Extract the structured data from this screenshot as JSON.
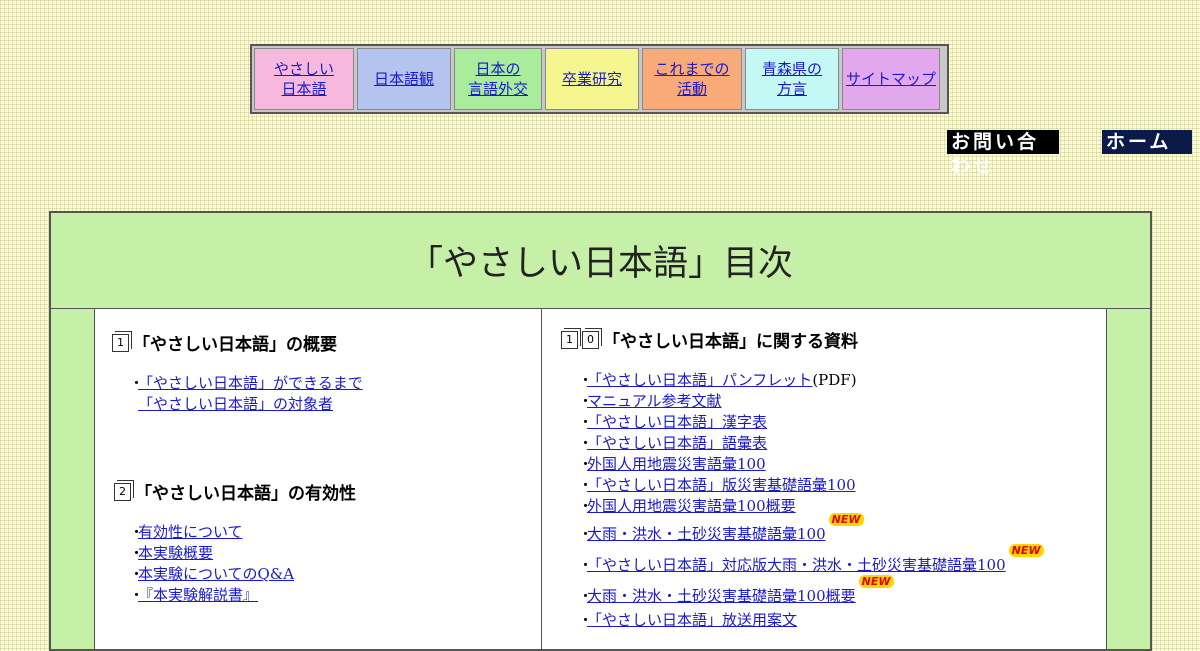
{
  "nav": [
    {
      "label": "やさしい\n日本語",
      "bg": "#f6b8dc"
    },
    {
      "label": "日本語観",
      "bg": "#b4c4ee"
    },
    {
      "label": "日本の\n言語外交",
      "bg": "#a8ec9c"
    },
    {
      "label": "卒業研究",
      "bg": "#f6f690"
    },
    {
      "label": "これまでの\n活動",
      "bg": "#f8aa78"
    },
    {
      "label": "青森県の\n方言",
      "bg": "#c4f8f4"
    },
    {
      "label": "サイトマップ",
      "bg": "#e2a8ee"
    }
  ],
  "header_links": {
    "contact": "お問い合わせ",
    "home": "ホーム"
  },
  "title": "「やさしい日本語」目次",
  "left": {
    "sec1": {
      "num": "1",
      "title": "「やさしい日本語」の概要",
      "items": [
        {
          "bullet": "・",
          "text": "「やさしい日本語」ができるまで"
        },
        {
          "bullet": "",
          "text": "「やさしい日本語」の対象者"
        }
      ]
    },
    "sec2": {
      "num": "2",
      "title": "「やさしい日本語」の有効性",
      "items": [
        {
          "bullet": "・",
          "text": "有効性について"
        },
        {
          "bullet": "・",
          "text": "本実験概要"
        },
        {
          "bullet": "・",
          "text": "本実験についてのQ&A"
        },
        {
          "bullet": "・",
          "text": "『本実験解説書』"
        }
      ]
    }
  },
  "right": {
    "sec": {
      "num1": "1",
      "num2": "0",
      "title": "「やさしい日本語」に関する資料",
      "new_label": "NEW",
      "items": [
        {
          "text": "「やさしい日本語」パンフレット",
          "suffix": "(PDF)"
        },
        {
          "text": "マニュアル参考文献"
        },
        {
          "text": "「やさしい日本語」漢字表"
        },
        {
          "text": "「やさしい日本語」語彙表"
        },
        {
          "text": "外国人用地震災害語彙100"
        },
        {
          "text": "「やさしい日本語」版災害基礎語彙100"
        },
        {
          "text": "外国人用地震災害語彙100概要"
        },
        {
          "text": "大雨・洪水・土砂災害基礎語彙100",
          "new": true
        },
        {
          "text": "「やさしい日本語」対応版大雨・洪水・土砂災害基礎語彙100",
          "new": true
        },
        {
          "text": "大雨・洪水・土砂災害基礎語彙100概要",
          "new": true
        },
        {
          "text": "「やさしい日本語」放送用案文"
        }
      ]
    }
  }
}
